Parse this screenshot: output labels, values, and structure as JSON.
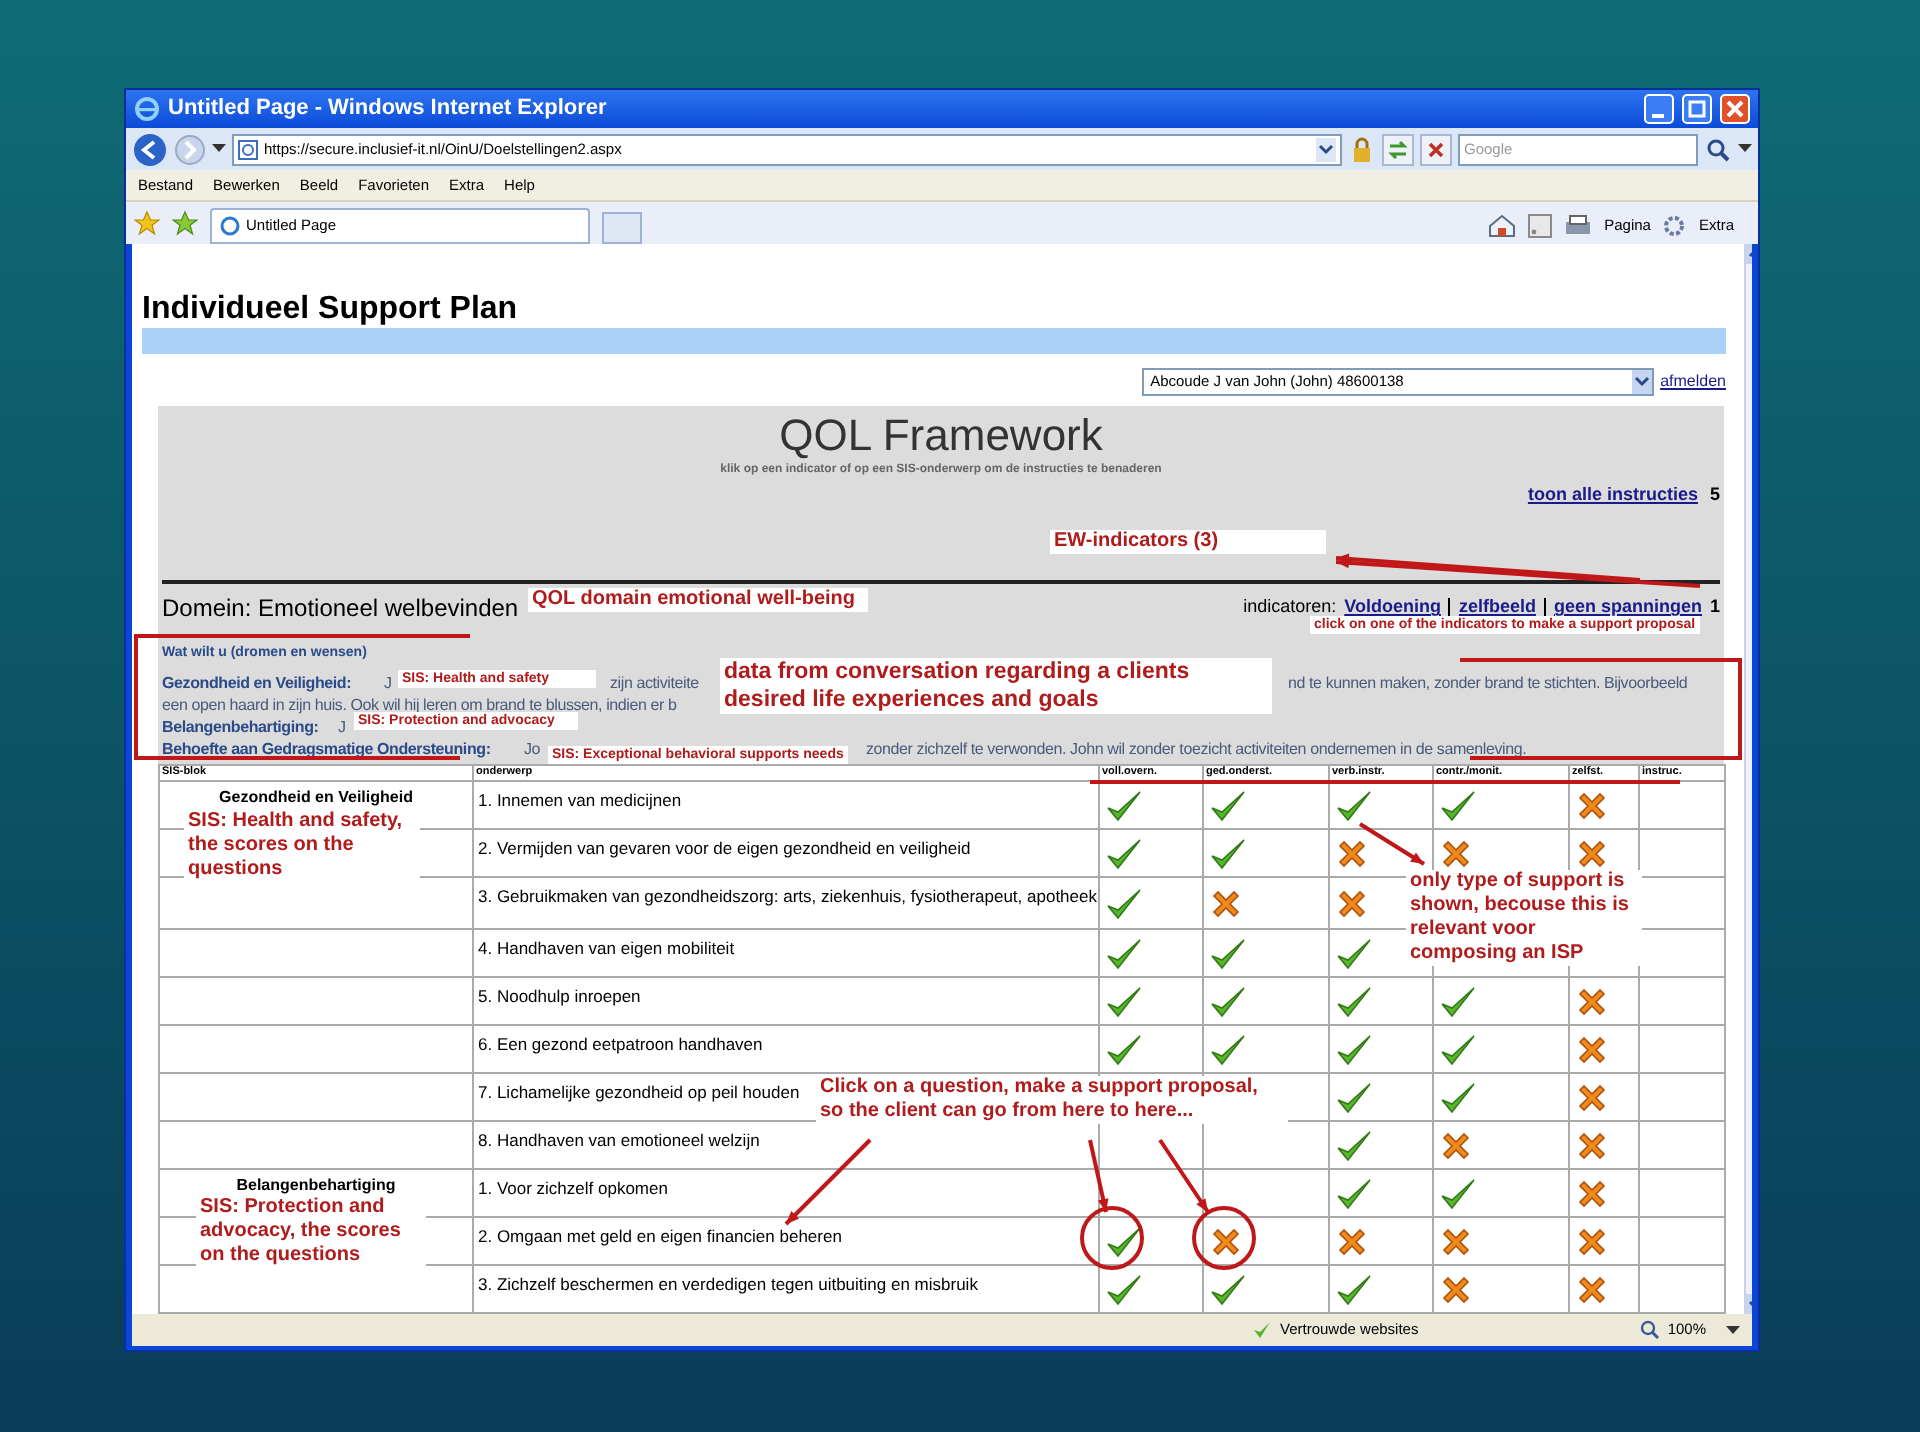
{
  "window": {
    "title": "Untitled Page - Windows Internet Explorer"
  },
  "address_bar": {
    "url": "https://secure.inclusief-it.nl/OinU/Doelstellingen2.aspx"
  },
  "search": {
    "placeholder": "Google"
  },
  "menu": [
    "Bestand",
    "Bewerken",
    "Beeld",
    "Favorieten",
    "Extra",
    "Help"
  ],
  "tab": {
    "label": "Untitled Page"
  },
  "toolbar": [
    "Pagina",
    "Extra"
  ],
  "page": {
    "title": "Individueel Support Plan",
    "client_select": "Abcoude J van John (John) 48600138",
    "logout": "afmelden",
    "heading": "QOL Framework",
    "subheading": "klik op een indicator of op een SIS-onderwerp om de instructies te benaderen",
    "show_instructions": "toon alle instructies",
    "show_instructions_count": "5",
    "domain": "Domein: Emotioneel welbevinden",
    "indicators_label": "indicatoren:",
    "indicators": [
      "Voldoening",
      "zelfbeeld",
      "geen spanningen"
    ],
    "indicators_count": "1",
    "wishes_title": "Wat wilt u (dromen en wensen)",
    "description_lines": [
      [
        {
          "kind": "label",
          "text": "Gezondheid en Veiligheid:"
        },
        {
          "kind": "text",
          "text": "J"
        },
        {
          "kind": "text",
          "text": "zijn activiteite"
        },
        {
          "kind": "text",
          "text": "nd te kunnen maken, zonder brand te stichten. Bijvoorbeeld"
        }
      ],
      [
        {
          "kind": "text",
          "text": "een open haard in zijn huis. Ook wil hij leren om brand te blussen, indien er b"
        }
      ],
      [
        {
          "kind": "label",
          "text": "Belangenbehartiging:"
        },
        {
          "kind": "text",
          "text": "J"
        }
      ],
      [
        {
          "kind": "label",
          "text": "Behoefte aan Gedragsmatige Ondersteuning:"
        },
        {
          "kind": "text",
          "text": "Jo"
        },
        {
          "kind": "text",
          "text": "zonder zichzelf te verwonden. John wil zonder toezicht activiteiten ondernemen in de samenleving."
        }
      ]
    ]
  },
  "table": {
    "columns": [
      "SIS-blok",
      "onderwerp",
      "voll.overn.",
      "ged.onderst.",
      "verb.instr.",
      "contr./monit.",
      "zelfst.",
      "instruc."
    ],
    "groups": [
      {
        "label": "Gezondheid en Veiligheid",
        "rows": [
          {
            "subject": "1. Innemen van medicijnen",
            "voll_overn": true,
            "ged_onderst": true,
            "verb_instr": true,
            "contr_monit": true,
            "zelfst": false
          },
          {
            "subject": "2. Vermijden van gevaren voor de eigen gezondheid en veiligheid",
            "voll_overn": true,
            "ged_onderst": true,
            "verb_instr": false,
            "contr_monit": false,
            "zelfst": false
          },
          {
            "subject": "3. Gebruikmaken van gezondheidszorg: arts, ziekenhuis, fysiotherapeut, apotheek",
            "voll_overn": true,
            "ged_onderst": false,
            "verb_instr": false
          },
          {
            "subject": "4. Handhaven van eigen mobiliteit",
            "voll_overn": true,
            "ged_onderst": true,
            "verb_instr": true
          },
          {
            "subject": "5. Noodhulp inroepen",
            "voll_overn": true,
            "ged_onderst": true,
            "verb_instr": true,
            "contr_monit": true,
            "zelfst": false
          },
          {
            "subject": "6. Een gezond eetpatroon handhaven",
            "voll_overn": true,
            "ged_onderst": true,
            "verb_instr": true,
            "contr_monit": true,
            "zelfst": false
          },
          {
            "subject": "7. Lichamelijke gezondheid op peil houden",
            "verb_instr": true,
            "contr_monit": true,
            "zelfst": false
          },
          {
            "subject": "8. Handhaven van emotioneel welzijn",
            "verb_instr": true,
            "contr_monit": false,
            "zelfst": false
          }
        ]
      },
      {
        "label": "Belangenbehartiging",
        "rows": [
          {
            "subject": "1. Voor zichzelf opkomen",
            "verb_instr": true,
            "contr_monit": true,
            "zelfst": false
          },
          {
            "subject": "2. Omgaan met geld en eigen financien beheren",
            "voll_overn": true,
            "ged_onderst": false,
            "verb_instr": false,
            "contr_monit": false,
            "zelfst": false
          },
          {
            "subject": "3. Zichzelf beschermen en verdedigen tegen uitbuiting en misbruik",
            "voll_overn": true,
            "ged_onderst": true,
            "verb_instr": true,
            "contr_monit": false,
            "zelfst": false
          }
        ]
      }
    ]
  },
  "annotations": [
    {
      "kind": "note",
      "text": "EW-indicators (3)"
    },
    {
      "kind": "note",
      "text": "QOL domain emotional well-being"
    },
    {
      "kind": "small_note",
      "text": "click on one of the indicators to make a support proposal"
    },
    {
      "kind": "small_note",
      "text": "SIS: Health and safety"
    },
    {
      "kind": "note",
      "text": "data from conversation regarding a clients desired life experiences and goals"
    },
    {
      "kind": "small_note",
      "text": "SIS: Protection and advocacy"
    },
    {
      "kind": "small_note",
      "text": "SIS: Exceptional behavioral supports needs"
    },
    {
      "kind": "note",
      "text": "SIS: Health and safety, the scores on the questions"
    },
    {
      "kind": "note",
      "text": "only type of support is shown, becouse this is relevant voor composing an ISP"
    },
    {
      "kind": "note",
      "text": "Click on a question, make a support proposal, so the client can go from here to here..."
    },
    {
      "kind": "note",
      "text": "SIS: Protection and advocacy, the scores on the questions"
    }
  ],
  "status_bar": {
    "zone": "Vertrouwde websites",
    "zoom": "100%"
  }
}
